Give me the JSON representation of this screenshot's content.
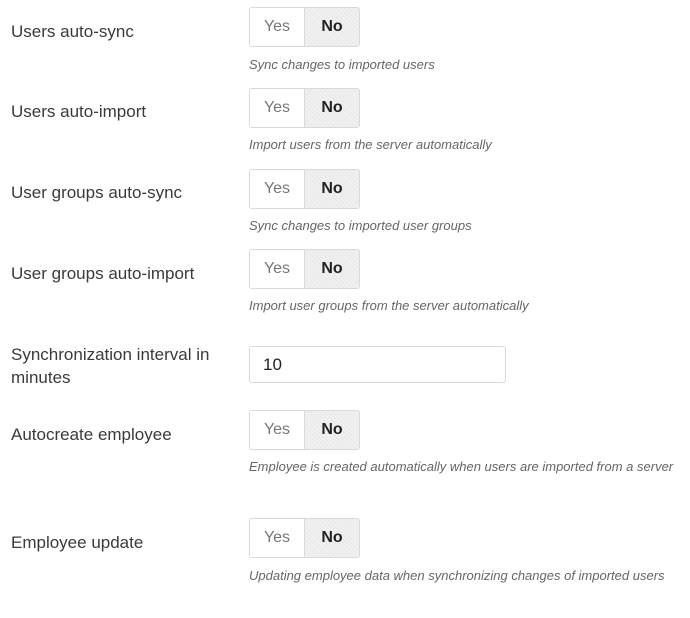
{
  "options": {
    "yes": "Yes",
    "no": "No"
  },
  "settings": [
    {
      "label": "Users auto-sync",
      "value": "No",
      "help": "Sync changes to imported users"
    },
    {
      "label": "Users auto-import",
      "value": "No",
      "help": "Import users from the server automatically"
    },
    {
      "label": "User groups auto-sync",
      "value": "No",
      "help": "Sync changes to imported user groups"
    },
    {
      "label": "User groups auto-import",
      "value": "No",
      "help": "Import user groups from the server automatically"
    },
    {
      "label": "Synchronization interval in minutes",
      "value": "10"
    },
    {
      "label": "Autocreate employee",
      "value": "No",
      "help": "Employee is created automatically when users are imported from a server"
    },
    {
      "label": "Employee update",
      "value": "No",
      "help": "Updating employee data when synchronizing changes of imported users"
    }
  ]
}
